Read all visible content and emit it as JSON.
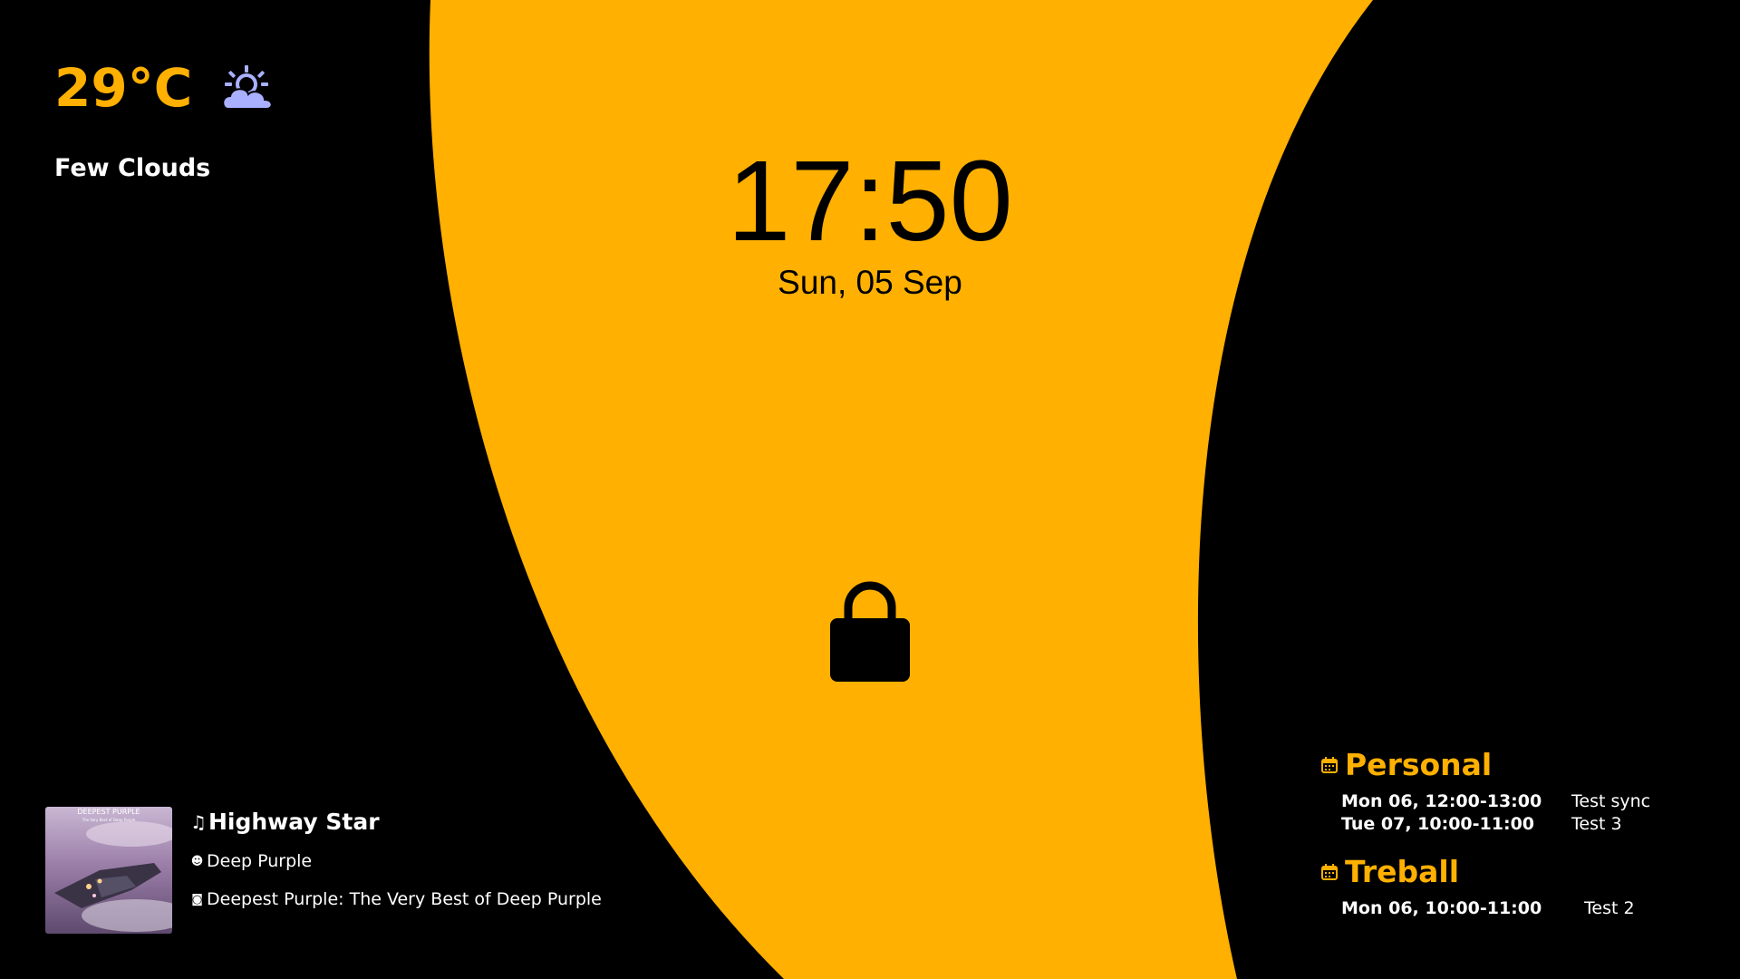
{
  "colors": {
    "accent": "#ffb000",
    "background": "#000000",
    "text": "#ffffff",
    "weather_icon": "#a9b0ff"
  },
  "weather": {
    "temperature": "29°C",
    "icon": "sun-behind-cloud-icon",
    "condition": "Few Clouds"
  },
  "clock": {
    "time": "17:50",
    "date": "Sun, 05 Sep"
  },
  "lock": {
    "icon": "padlock-icon"
  },
  "media": {
    "track": "Highway Star",
    "artist": "Deep Purple",
    "album": "Deepest Purple: The Very Best of Deep Purple",
    "cover_title": "DEEPEST PURPLE",
    "cover_subtitle": "The Very Best of Deep Purple",
    "track_icon": "music-note-icon",
    "artist_icon": "person-icon",
    "album_icon": "disc-icon"
  },
  "calendar": [
    {
      "name": "Personal",
      "events": [
        {
          "when": "Mon 06, 12:00-13:00",
          "title": "Test sync"
        },
        {
          "when": "Tue 07, 10:00-11:00",
          "title": "Test 3"
        }
      ]
    },
    {
      "name": "Treball",
      "events": [
        {
          "when": "Mon 06, 10:00-11:00",
          "title": "Test 2"
        }
      ]
    }
  ]
}
